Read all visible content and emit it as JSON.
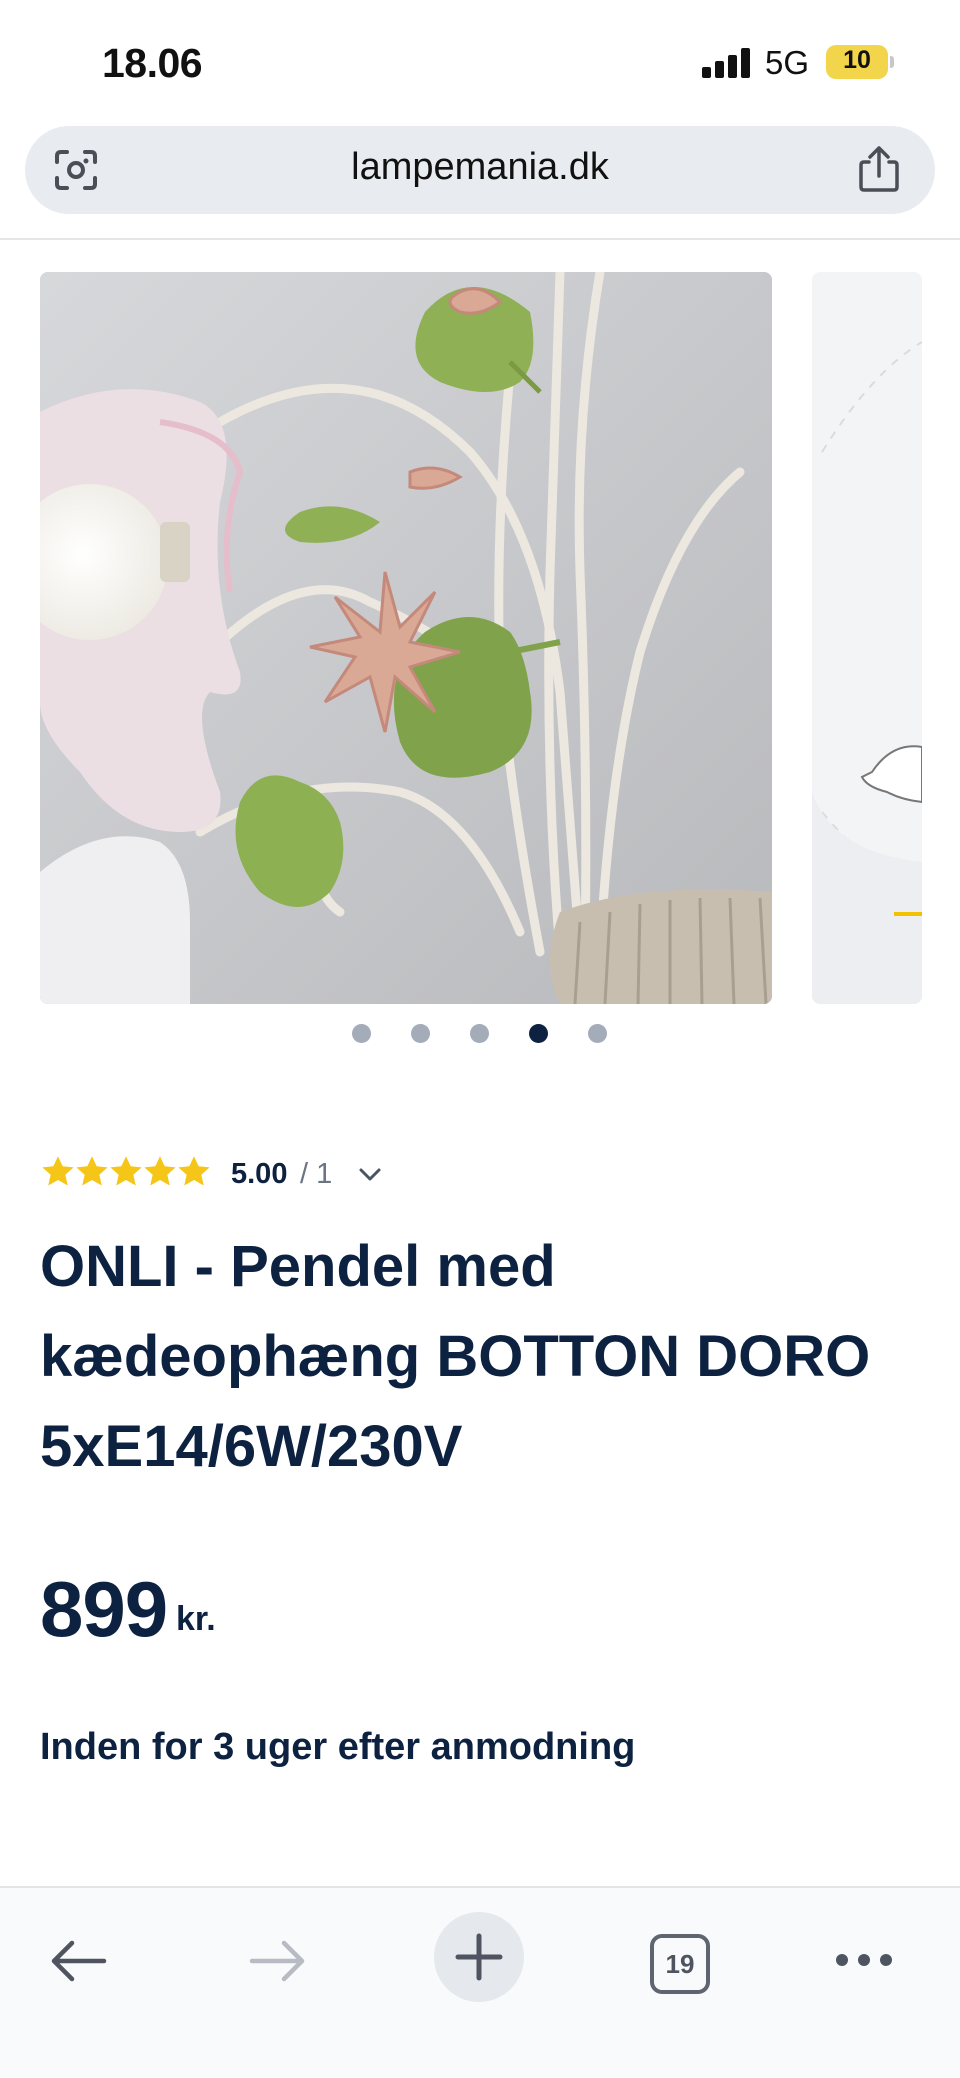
{
  "status_bar": {
    "time": "18.06",
    "network": "5G",
    "battery": "10"
  },
  "browser": {
    "url": "lampemania.dk",
    "icons": {
      "lens": "camera-lens-icon",
      "share": "share-icon"
    }
  },
  "gallery": {
    "image_count": 5,
    "active_index": 3
  },
  "rating": {
    "stars": 5,
    "score": "5.00",
    "count": "/ 1",
    "star_color": "#f5c518"
  },
  "product": {
    "title": "ONLI - Pendel med kædeophæng BOTTON DORO 5xE14/6W/230V",
    "price": "899",
    "currency": "kr.",
    "delivery": "Inden for 3 uger efter anmodning"
  },
  "toolbar": {
    "tabs_count": "19",
    "icons": {
      "back": "back-arrow-icon",
      "forward": "forward-arrow-icon",
      "new_tab": "plus-icon",
      "tabs": "tabs-icon",
      "more": "more-dots-icon"
    }
  },
  "colors": {
    "brand_text": "#0d2240",
    "accent": "#f5c518",
    "dot_inactive": "#a3acb8"
  }
}
